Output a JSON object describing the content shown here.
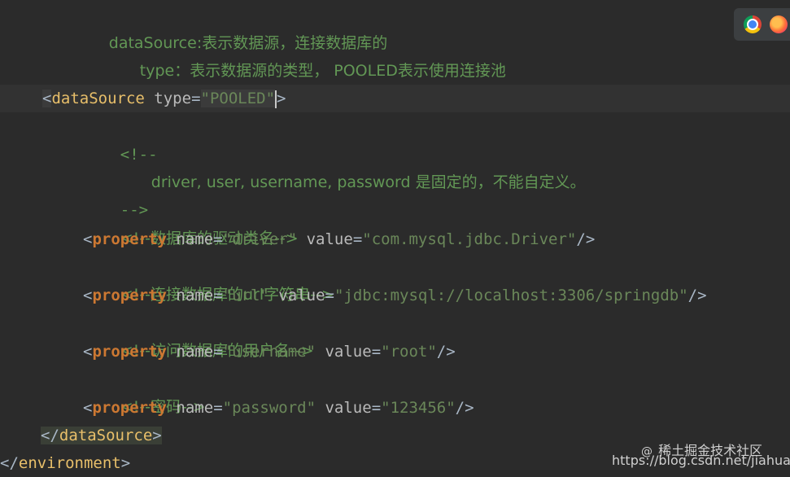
{
  "code": {
    "line1_comment": "dataSource:表示数据源，连接数据库的",
    "line2_comment": "type：表示数据源的类型， POOLED表示使用连接池",
    "line3_comment_close": "-->",
    "ds_open": {
      "tag": "dataSource",
      "attr": "type",
      "value": "\"POOLED\""
    },
    "c_open": "<!--",
    "c_body": "driver, user, username, password 是固定的，不能自定义。",
    "c_close": "-->",
    "c_driver": "<!--数据库的驱动类名-->",
    "prop_driver": {
      "tag": "property",
      "name_attr": "name",
      "name_val": "\"driver\"",
      "value_attr": "value",
      "value_val": "\"com.mysql.jdbc.Driver\""
    },
    "c_url": "<!--连接数据库的url字符串-->",
    "prop_url": {
      "tag": "property",
      "name_attr": "name",
      "name_val": "\"url\"",
      "value_attr": "value",
      "value_val": "\"jdbc:mysql://localhost:3306/springdb\""
    },
    "c_user": "<!--访问数据库的用户名-->",
    "prop_user": {
      "tag": "property",
      "name_attr": "name",
      "name_val": "\"username\"",
      "value_attr": "value",
      "value_val": "\"root\""
    },
    "c_pwd": "<!--密码-->",
    "prop_pwd": {
      "tag": "property",
      "name_attr": "name",
      "name_val": "\"password\"",
      "value_attr": "value",
      "value_val": "\"123456\""
    },
    "ds_close": "dataSource",
    "env_close": "environment"
  },
  "overlay": {
    "browser_icons": [
      "chrome-icon",
      "firefox-icon"
    ],
    "watermark_logo": "@",
    "watermark_text": "稀土掘金技术社区",
    "watermark_url": "https://blog.csdn.net/jiahuan_"
  },
  "colors": {
    "background": "#2b2b2b",
    "comment": "#629755",
    "tag": "#e8bf6a",
    "keyword": "#cc7832",
    "string": "#6a8759"
  }
}
